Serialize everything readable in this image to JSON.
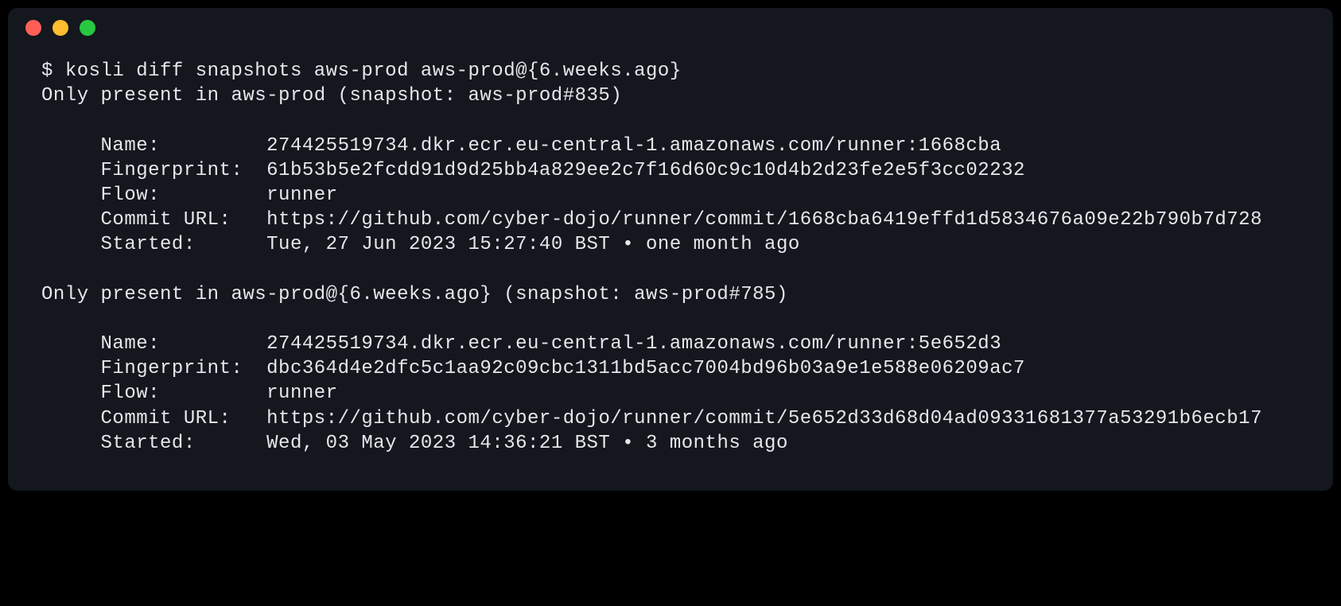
{
  "prompt": "$",
  "command": "kosli diff snapshots aws-prod aws-prod@{6.weeks.ago}",
  "sections": [
    {
      "header": "Only present in aws-prod (snapshot: aws-prod#835)",
      "name": "274425519734.dkr.ecr.eu-central-1.amazonaws.com/runner:1668cba",
      "fingerprint": "61b53b5e2fcdd91d9d25bb4a829ee2c7f16d60c9c10d4b2d23fe2e5f3cc02232",
      "flow": "runner",
      "commit_url": "https://github.com/cyber-dojo/runner/commit/1668cba6419effd1d5834676a09e22b790b7d728",
      "started": "Tue, 27 Jun 2023 15:27:40 BST • one month ago"
    },
    {
      "header": "Only present in aws-prod@{6.weeks.ago} (snapshot: aws-prod#785)",
      "name": "274425519734.dkr.ecr.eu-central-1.amazonaws.com/runner:5e652d3",
      "fingerprint": "dbc364d4e2dfc5c1aa92c09cbc1311bd5acc7004bd96b03a9e1e588e06209ac7",
      "flow": "runner",
      "commit_url": "https://github.com/cyber-dojo/runner/commit/5e652d33d68d04ad09331681377a53291b6ecb17",
      "started": "Wed, 03 May 2023 14:36:21 BST • 3 months ago"
    }
  ],
  "labels": {
    "name": "Name:",
    "fingerprint": "Fingerprint:",
    "flow": "Flow:",
    "commit_url": "Commit URL:",
    "started": "Started:"
  }
}
